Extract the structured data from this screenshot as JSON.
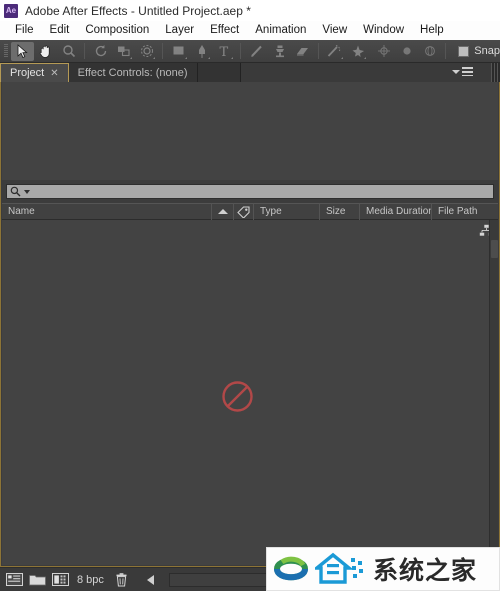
{
  "window": {
    "app_badge": "Ae",
    "title": "Adobe After Effects - Untitled Project.aep *"
  },
  "menubar": {
    "items": [
      {
        "label": "File"
      },
      {
        "label": "Edit"
      },
      {
        "label": "Composition"
      },
      {
        "label": "Layer"
      },
      {
        "label": "Effect"
      },
      {
        "label": "Animation"
      },
      {
        "label": "View"
      },
      {
        "label": "Window"
      },
      {
        "label": "Help"
      }
    ]
  },
  "toolbar": {
    "tools": [
      {
        "name": "selection-tool-icon",
        "active": true
      },
      {
        "name": "hand-tool-icon",
        "active": false
      },
      {
        "name": "zoom-tool-icon",
        "active": false
      },
      {
        "name": "rotation-tool-icon",
        "active": false
      },
      {
        "name": "camera-orbit-tool-icon",
        "active": false
      },
      {
        "name": "pan-behind-tool-icon",
        "active": false
      },
      {
        "name": "shape-tool-icon",
        "active": false
      },
      {
        "name": "pen-tool-icon",
        "active": false
      },
      {
        "name": "type-tool-icon",
        "active": false
      },
      {
        "name": "brush-tool-icon",
        "active": false
      },
      {
        "name": "clone-stamp-tool-icon",
        "active": false
      },
      {
        "name": "eraser-tool-icon",
        "active": false
      },
      {
        "name": "roto-brush-tool-icon",
        "active": false
      },
      {
        "name": "puppet-pin-tool-icon",
        "active": false
      }
    ],
    "snap_label": "Snap"
  },
  "tabs": [
    {
      "label": "Project",
      "active": true,
      "closable": true
    },
    {
      "label": "Effect Controls: (none)",
      "active": false,
      "closable": false
    }
  ],
  "search": {
    "value": "",
    "placeholder": ""
  },
  "columns": [
    {
      "label": "Name",
      "name": "column-name"
    },
    {
      "label": "",
      "name": "column-sort-arrow"
    },
    {
      "label": "",
      "name": "column-label-tag"
    },
    {
      "label": "Type",
      "name": "column-type"
    },
    {
      "label": "Size",
      "name": "column-size"
    },
    {
      "label": "Media Duration",
      "name": "column-media-duration"
    },
    {
      "label": "File Path",
      "name": "column-file-path"
    }
  ],
  "list": {
    "empty_indicator": "no-entry-icon",
    "items": []
  },
  "bottombar": {
    "buttons": [
      {
        "name": "new-composition-button"
      },
      {
        "name": "new-folder-button"
      },
      {
        "name": "project-settings-button"
      }
    ],
    "bit_depth": "8 bpc",
    "delete_button": "delete-button",
    "back_button": "back-arrow-button"
  },
  "watermark": {
    "text": "系统之家"
  },
  "colors": {
    "accent_gold": "#8d7436",
    "panel_bg": "#3c3c3c",
    "list_bg": "#434343",
    "toolbar_bg": "#454545",
    "titlebar_bg": "#ffffff",
    "no_entry_red": "#b04040",
    "ae_purple": "#4c2b7a",
    "watermark_blue": "#1b9ad6"
  }
}
